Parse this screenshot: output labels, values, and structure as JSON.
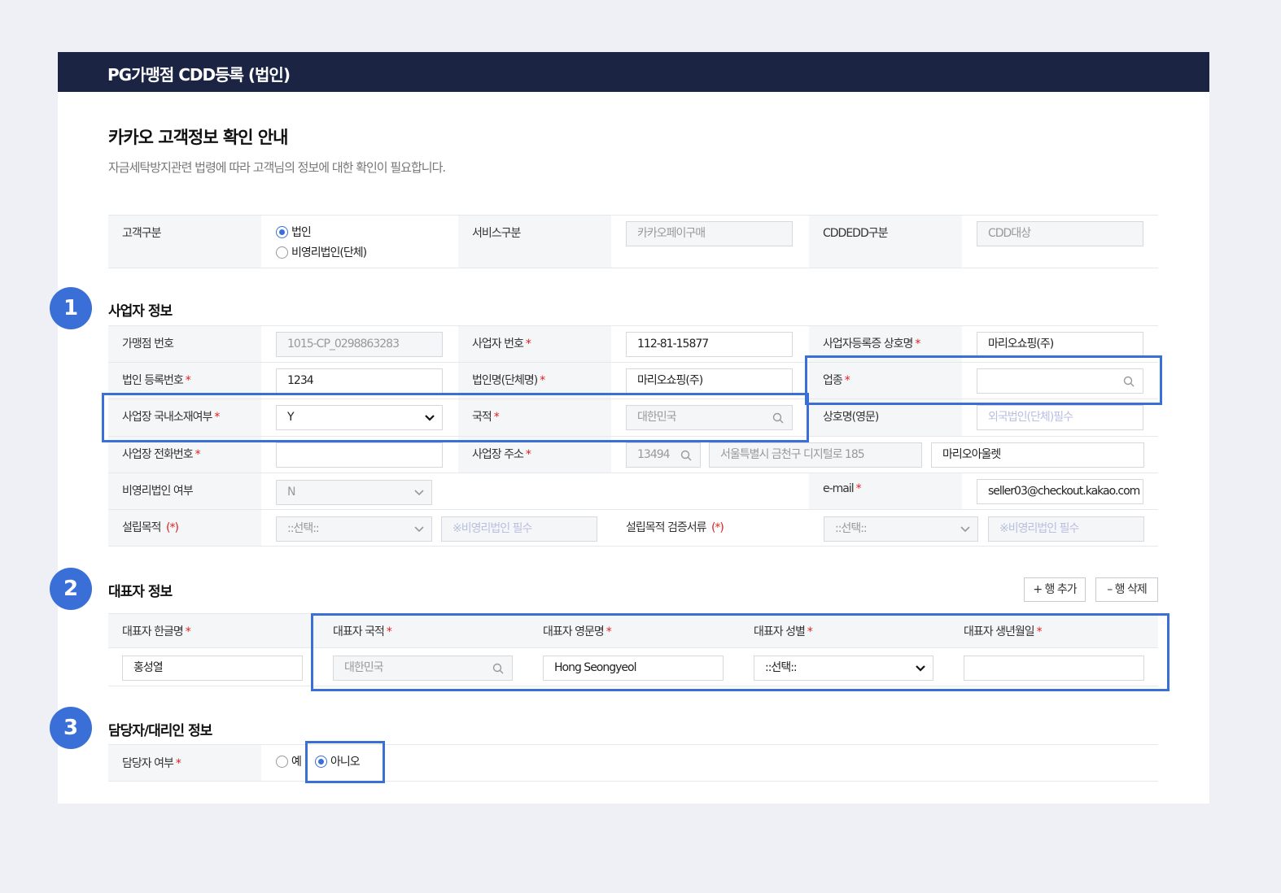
{
  "header": {
    "title": "PG가맹점 CDD등록 (법인)"
  },
  "notice": {
    "title": "카카오 고객정보 확인 안내",
    "description": "자금세탁방지관련 법령에 따라 고객님의 정보에 대한 확인이 필요합니다."
  },
  "customer": {
    "type_label": "고객구분",
    "type_options": [
      "법인",
      "비영리법인(단체)"
    ],
    "service_label": "서비스구분",
    "service_value": "카카오페이구매",
    "cdd_label": "CDDEDD구분",
    "cdd_value": "CDD대상"
  },
  "sections": {
    "business": {
      "num": "1",
      "title": "사업자 정보"
    },
    "representative": {
      "num": "2",
      "title": "대표자 정보"
    },
    "manager": {
      "num": "3",
      "title": "담당자/대리인 정보"
    }
  },
  "business": {
    "merchant_no_label": "가맹점 번호",
    "merchant_no": "1015-CP_0298863283",
    "biz_no_label": "사업자 번호",
    "biz_no": "112-81-15877",
    "biz_name_label": "사업자등록증 상호명",
    "biz_name": "마리오쇼핑(주)",
    "corp_reg_label": "법인 등록번호",
    "corp_reg": "1234",
    "corp_name_label": "법인명(단체명)",
    "corp_name": "마리오쇼핑(주)",
    "industry_label": "업종",
    "domestic_label": "사업장 국내소재여부",
    "domestic_value": "Y",
    "nationality_label": "국적",
    "nationality_value": "대한민국",
    "eng_name_label": "상호명(영문)",
    "eng_name_placeholder": "외국법인(단체)필수",
    "phone_label": "사업장 전화번호",
    "address_label": "사업장 주소",
    "zip": "13494",
    "address1": "서울특별시 금천구 디지털로 185",
    "address2": "마리오아울렛",
    "nonprofit_label": "비영리법인 여부",
    "nonprofit_value": "N",
    "email_label": "e-mail",
    "email": "seller03@checkout.kakao.com",
    "purpose_label": "설립목적",
    "purpose_req": "(*)",
    "purpose_select": "::선택::",
    "purpose_placeholder": "※비영리법인 필수",
    "purpose_doc_label": "설립목적 검증서류",
    "purpose_doc_req": "(*)",
    "purpose_doc_select": "::선택::",
    "purpose_doc_placeholder": "※비영리법인 필수"
  },
  "representative": {
    "add_row": "+ 행 추가",
    "del_row": "– 행 삭제",
    "kor_name_label": "대표자 한글명",
    "kor_name": "홍성열",
    "nationality_label": "대표자 국적",
    "nationality": "대한민국",
    "eng_name_label": "대표자 영문명",
    "eng_name": "Hong Seongyeol",
    "gender_label": "대표자 성별",
    "gender": "::선택::",
    "birth_label": "대표자 생년월일"
  },
  "manager": {
    "label": "담당자 여부",
    "options": [
      "예",
      "아니오"
    ]
  },
  "required_mark": "*",
  "colors": {
    "header_bg": "#1c2444",
    "accent": "#3b6fd8",
    "required": "#e02020"
  }
}
